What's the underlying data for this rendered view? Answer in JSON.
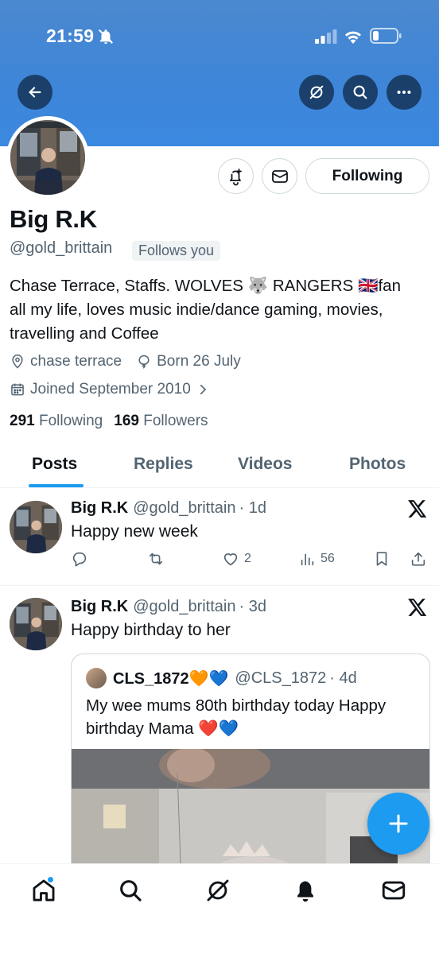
{
  "status_bar": {
    "time": "21:59"
  },
  "profile": {
    "name": "Big R.K",
    "handle": "@gold_brittain",
    "follows_you": "Follows you",
    "bio_line1": "Chase Terrace, Staffs. WOLVES 🐺 RANGERS 🇬🇧fan",
    "bio_line2": "all my life, loves music indie/dance gaming, movies,",
    "bio_line3": "travelling and Coffee",
    "location": "chase terrace",
    "birthday": "Born 26 July",
    "joined": "Joined September 2010",
    "following_count": "291",
    "following_label": "Following",
    "followers_count": "169",
    "followers_label": "Followers",
    "follow_button_label": "Following"
  },
  "tabs": [
    "Posts",
    "Replies",
    "Videos",
    "Photos"
  ],
  "tweets": [
    {
      "name": "Big R.K",
      "handle": "@gold_brittain",
      "time": "· 1d",
      "text": "Happy new week",
      "likes": "2",
      "views": "56"
    },
    {
      "name": "Big R.K",
      "handle": "@gold_brittain",
      "time": "· 3d",
      "text": "Happy birthday to her",
      "quote": {
        "name": "CLS_1872🧡💙",
        "handle": "@CLS_1872",
        "time": "· 4d",
        "text_line1": "My wee mums 80th birthday today Happy",
        "text_line2": "birthday Mama ❤️💙"
      }
    }
  ],
  "colors": {
    "accent": "#1d9bf0",
    "banner": "#3f86d8",
    "secondary_text": "#536471"
  },
  "icons": [
    "back-arrow-icon",
    "grok-icon",
    "search-icon",
    "more-icon",
    "notification-add-icon",
    "message-icon",
    "location-icon",
    "birthday-icon",
    "calendar-icon",
    "chevron-right-icon",
    "reply-icon",
    "repost-icon",
    "like-icon",
    "views-icon",
    "bookmark-icon",
    "share-icon",
    "x-logo-icon",
    "plus-icon",
    "home-icon",
    "bell-icon",
    "mail-icon"
  ]
}
